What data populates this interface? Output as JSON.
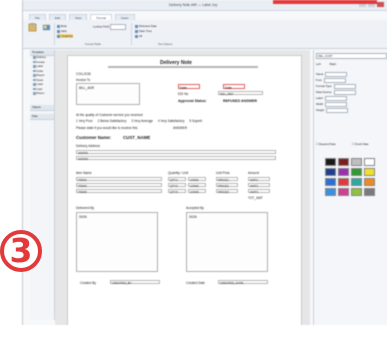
{
  "window": {
    "title": "Delivery Note.AIR — Label Joy"
  },
  "ribbon": {
    "tabs": [
      "File",
      "Edit",
      "View",
      "Format",
      "Insert"
    ],
    "field_label": "Lookup Field",
    "check_boxes": [
      "Bold",
      "Italic",
      "Underline"
    ],
    "options": [
      "Relevant Date",
      "Date Time",
      "All"
    ],
    "group_labels": [
      "",
      "Format Fields",
      "",
      "Text Options"
    ]
  },
  "nav": {
    "header": "Templates",
    "items": [
      "Delivery",
      "Invoice",
      "Label",
      "Order",
      "Report",
      "Stock",
      "Letter",
      "Card",
      "Return"
    ],
    "section2": "Objects",
    "section3": "Data"
  },
  "doc": {
    "title": "Delivery Note",
    "company": "COLLEGE",
    "invoice_to": "Invoice To",
    "bill_addr": "BILL_ADR",
    "date_a": "Date",
    "date_b": "Date",
    "edi_no_label": "EDI No",
    "edi_no_value": "DEL_REF",
    "approval_label": "Approval Status:",
    "approval_value": "REFUSED ANSWER",
    "delivery_info_label": "At the quality of Customer service you received",
    "rating": [
      "1",
      "Very Poor",
      "2",
      "Below Satisfactory",
      "3",
      "Very Average",
      "4",
      "Very Satisfactory",
      "5",
      "Superb"
    ],
    "delivered_label": "Please state if you would like to receive this",
    "delivered_value": "ANSWER",
    "customer_name_label": "Customer Name:",
    "customer_name_value": "CUST_NAME",
    "delivery_address_label": "Delivery Address",
    "addr_rows": [
      "ADDR1",
      "ADDR2"
    ],
    "items_headers": [
      "Item Name",
      "Quantity / Unit",
      "Unit Price",
      "Amount"
    ],
    "items": [
      {
        "name": "ITEM1",
        "qty": "QTY1",
        "unit": "UOM1",
        "price": "PRICE1",
        "amount": "AMT1"
      },
      {
        "name": "ITEM2",
        "qty": "QTY2",
        "unit": "UOM2",
        "price": "PRICE2",
        "amount": "AMT2"
      },
      {
        "name": "ITEM3",
        "qty": "QTY3",
        "unit": "UOM3",
        "price": "PRICE3",
        "amount": "AMT3"
      }
    ],
    "total": "TOT_AMT",
    "delivered_by_label": "Delivered By",
    "delivered_by_value": "SIGN",
    "accepted_by_label": "Accepted By",
    "accepted_by_value": "SIGN",
    "created_by_label": "Created By",
    "created_by_value": "CREATED_BY",
    "created_date_label": "Created Date",
    "created_date_value": "CREATED_DATE"
  },
  "props": {
    "selector": "DEL_CUST",
    "rows": [
      "Name",
      "Font",
      "Format Type",
      "Data Source",
      "Label",
      "Width",
      "Height"
    ],
    "align_left": "Left",
    "align_right": "Right",
    "checks": [
      "Expand Data",
      "Dock Data"
    ]
  },
  "badge": {
    "number": "3"
  },
  "colors": {
    "accent": "#e23a3a",
    "swatches": [
      "#1a1a1a",
      "#7a1f1f",
      "#bfbfbf",
      "#ffffff",
      "#1f3f8f",
      "#9a2fb0",
      "#2f9a2f",
      "#f0e02a",
      "#2a6fd8",
      "#e23a3a",
      "#2fa8a0",
      "#f08a20",
      "#3a8fe0",
      "#d04090",
      "#90c040",
      "#7a7a7a"
    ]
  }
}
